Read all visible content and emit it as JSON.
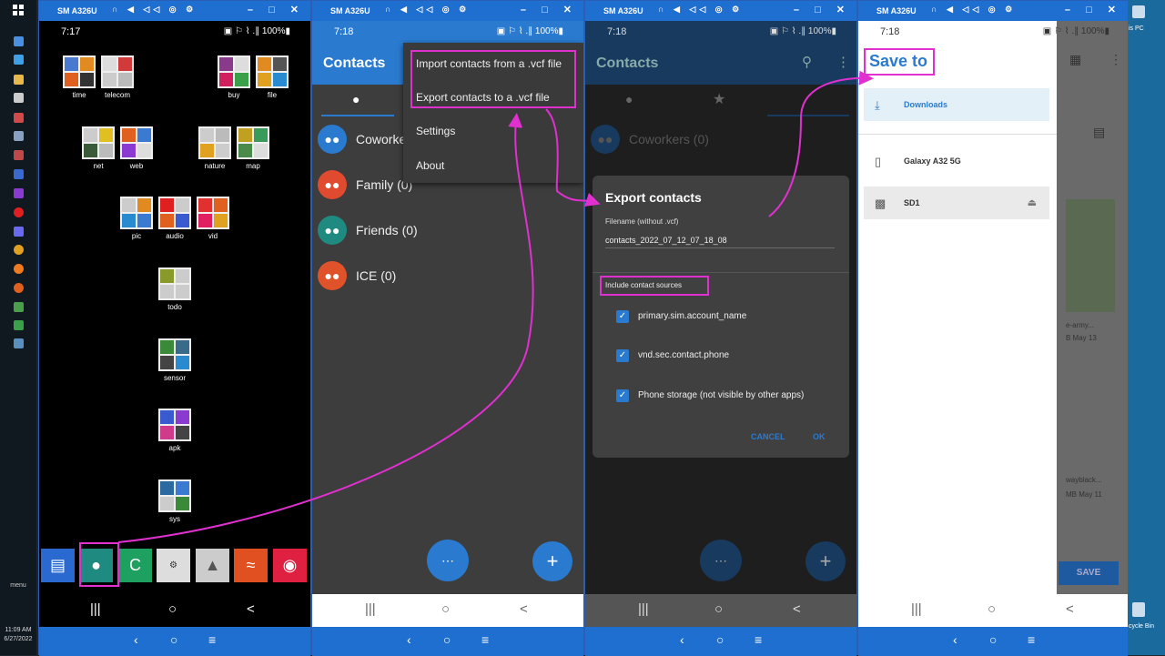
{
  "host": {
    "window_title": "SM A326U",
    "title_icons": "∩ ◀ ◁◁ ◎ ⚙",
    "window_controls": "– □ ✕",
    "nav_back": "‹",
    "nav_home": "○",
    "nav_menu": "≡",
    "menu_label": "menu",
    "clock_time": "11:09 AM",
    "clock_date": "6/27/2022",
    "desktop_label_pc": "is PC",
    "desktop_label_bin": "cycle Bin"
  },
  "phone_nav": {
    "recents": "|||",
    "home": "○",
    "back": "<"
  },
  "panel1": {
    "status_time": "7:17",
    "status_right": "▣ ⚐ ⌇ .∥ 100%▮",
    "folders": [
      {
        "label": "time"
      },
      {
        "label": "telecom"
      },
      {
        "label": "buy"
      },
      {
        "label": "file"
      },
      {
        "label": "net"
      },
      {
        "label": "web"
      },
      {
        "label": "nature"
      },
      {
        "label": "map"
      },
      {
        "label": "pic"
      },
      {
        "label": "audio"
      },
      {
        "label": "vid"
      },
      {
        "label": "todo"
      },
      {
        "label": "sensor"
      },
      {
        "label": "apk"
      },
      {
        "label": "sys"
      }
    ]
  },
  "panel2": {
    "status_time": "7:18",
    "status_right": "▣ ⚐ ⌇ .∥ 100%▮",
    "app_title": "Contacts",
    "groups": [
      {
        "label": "Coworke",
        "color": "#2a7bd0"
      },
      {
        "label": "Family (0)",
        "color": "#e04a2f"
      },
      {
        "label": "Friends (0)",
        "color": "#1e8a80"
      },
      {
        "label": "ICE (0)",
        "color": "#e0522a"
      }
    ],
    "menu": {
      "import": "Import contacts from a .vcf file",
      "export": "Export contacts to a .vcf file",
      "settings": "Settings",
      "about": "About"
    }
  },
  "panel3": {
    "status_time": "7:18",
    "status_right": "▣ ⚐ ⌇ .∥ 100%▮",
    "app_title": "Contacts",
    "bg_group": "Coworkers (0)",
    "dialog": {
      "title": "Export contacts",
      "filename_label": "Filename (without .vcf)",
      "filename_value": "contacts_2022_07_12_07_18_08",
      "sources_label": "Include contact sources",
      "sources": [
        {
          "label": "primary.sim.account_name",
          "checked": true
        },
        {
          "label": "vnd.sec.contact.phone",
          "checked": true
        },
        {
          "label": "Phone storage (not visible by other apps)",
          "checked": true
        }
      ],
      "cancel": "CANCEL",
      "ok": "OK"
    }
  },
  "panel4": {
    "status_time": "7:18",
    "status_right": "▣ ⚐ ⌇ .∥ 100%▮",
    "title": "Save to",
    "items": [
      {
        "label": "Downloads",
        "icon": "download-icon"
      },
      {
        "label": "Galaxy A32 5G",
        "icon": "phone-icon"
      },
      {
        "label": "SD1",
        "icon": "sd-card-icon"
      }
    ],
    "bg_text_1": "e-army...",
    "bg_text_2": "B May 13",
    "bg_text_3": "wayblаck...",
    "bg_text_4": "MB May 11",
    "bg_save": "SAVE"
  },
  "colors": {
    "accent": "#2a7bd0",
    "highlight": "#e030d0",
    "host_blue": "#1f6fd0"
  }
}
